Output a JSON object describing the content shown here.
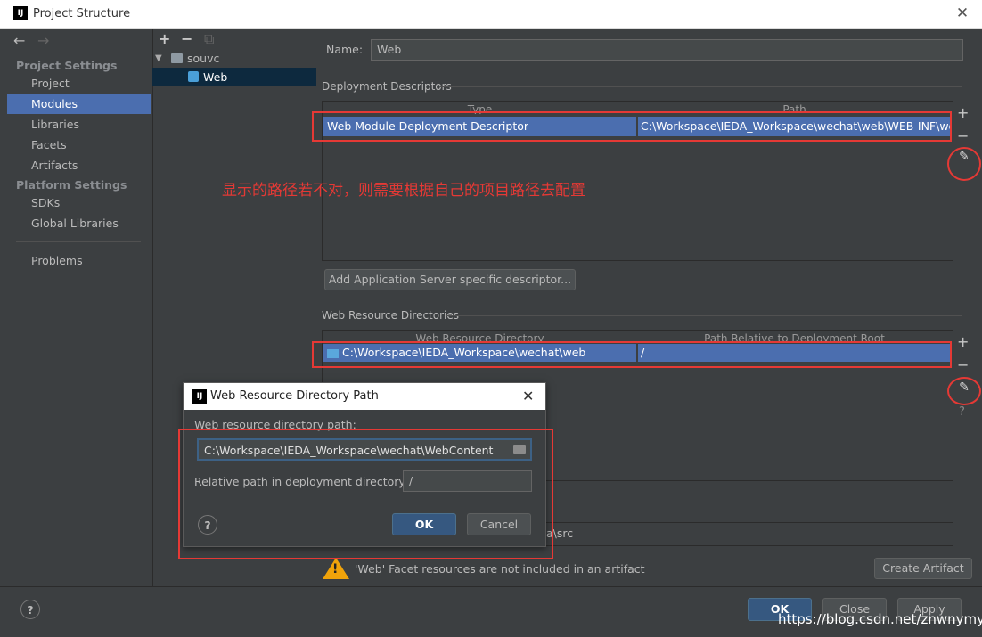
{
  "window": {
    "title": "Project Structure",
    "logo": "IJ",
    "close_glyph": "✕"
  },
  "nav": {
    "back_glyph": "←",
    "forward_glyph": "→"
  },
  "sidebar": {
    "project_settings_header": "Project Settings",
    "items_project": [
      "Project",
      "Modules",
      "Libraries",
      "Facets",
      "Artifacts"
    ],
    "platform_settings_header": "Platform Settings",
    "items_platform": [
      "SDKs",
      "Global Libraries"
    ],
    "problems": "Problems",
    "selected": "Modules"
  },
  "tree": {
    "toolbar": {
      "add": "+",
      "remove": "−",
      "copy": "⧉"
    },
    "root": "souvc",
    "child": "Web"
  },
  "main": {
    "name_label": "Name:",
    "name_value": "Web",
    "deployment_descriptors_title": "Deployment Descriptors",
    "dd_columns": [
      "Type",
      "Path"
    ],
    "dd_row": {
      "type": "Web Module Deployment Descriptor",
      "path": "C:\\Workspace\\IEDA_Workspace\\wechat\\web\\WEB-INF\\web.xml"
    },
    "add_server_descriptor_button": "Add Application Server specific descriptor...",
    "web_resource_dirs_title": "Web Resource Directories",
    "wr_columns": [
      "Web Resource Directory",
      "Path Relative to Deployment Root"
    ],
    "wr_row": {
      "dir": "C:\\Workspace\\IEDA_Workspace\\wechat\\web",
      "relative": "/"
    },
    "source_roots_partial": "a\\src",
    "warning_text": "'Web' Facet resources are not included in an artifact",
    "create_artifact_button": "Create Artifact",
    "side_add": "+",
    "side_remove": "−",
    "side_help": "?"
  },
  "annotation": "显示的路径若不对，则需要根据自己的项目路径去配置",
  "dialog": {
    "title": "Web Resource Directory Path",
    "path_label": "Web resource directory path:",
    "path_value": "C:\\Workspace\\IEDA_Workspace\\wechat\\WebContent",
    "relative_label": "Relative path in deployment directory:",
    "relative_value": "/",
    "ok": "OK",
    "cancel": "Cancel",
    "help": "?",
    "close_glyph": "✕"
  },
  "footer": {
    "help": "?",
    "ok": "OK",
    "close": "Close",
    "apply": "Apply"
  },
  "watermark": "https://blog.csdn.net/znwnymys",
  "colors": {
    "selection": "#4b6eaf",
    "annotation_red": "#e53935",
    "background": "#3c3f41"
  }
}
